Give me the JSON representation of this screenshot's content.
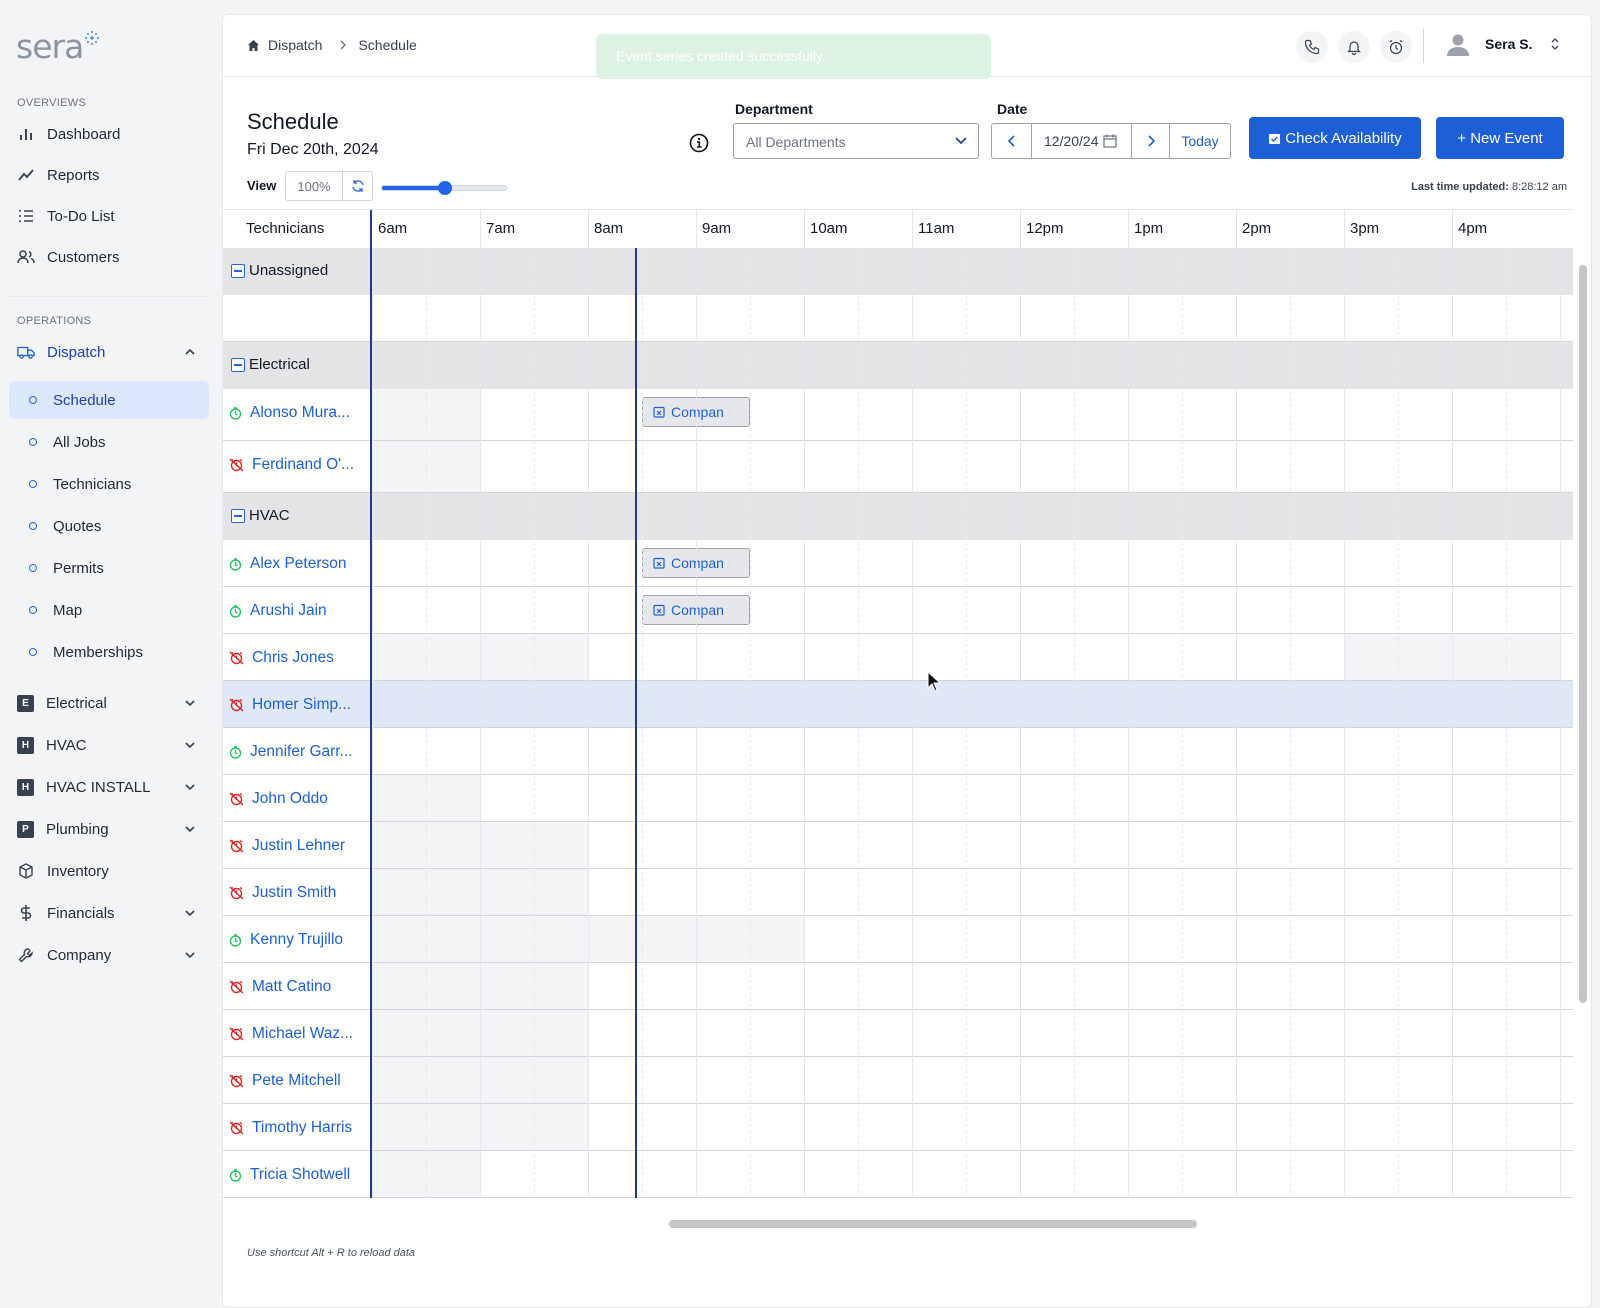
{
  "brand": {
    "logo_text": "sera"
  },
  "sidebar": {
    "overviews_label": "OVERVIEWS",
    "operations_label": "OPERATIONS",
    "overview_items": [
      {
        "label": "Dashboard",
        "icon": "bar-chart-icon"
      },
      {
        "label": "Reports",
        "icon": "trend-icon"
      },
      {
        "label": "To-Do List",
        "icon": "list-icon"
      },
      {
        "label": "Customers",
        "icon": "users-icon"
      }
    ],
    "dispatch_label": "Dispatch",
    "dispatch_sub": [
      "Schedule",
      "All Jobs",
      "Technicians",
      "Quotes",
      "Permits",
      "Map",
      "Memberships"
    ],
    "dept_items": [
      {
        "letter": "E",
        "label": "Electrical"
      },
      {
        "letter": "H",
        "label": "HVAC"
      },
      {
        "letter": "H",
        "label": "HVAC INSTALL"
      },
      {
        "letter": "P",
        "label": "Plumbing"
      }
    ],
    "inventory_label": "Inventory",
    "financials_label": "Financials",
    "company_label": "Company"
  },
  "topbar": {
    "breadcrumb": [
      "Dispatch",
      "Schedule"
    ],
    "toast": "Event series created successfully.",
    "user_name": "Sera S."
  },
  "header": {
    "title": "Schedule",
    "date": "Fri Dec 20th, 2024",
    "department_label": "Department",
    "department_value": "All Departments",
    "date_label": "Date",
    "date_value": "12/20/24",
    "today_label": "Today",
    "check_availability": "Check Availability",
    "new_event": "+ New Event",
    "view_label": "View",
    "zoom_value": "100%",
    "zoom_slider_fraction": 0.5,
    "last_updated_label": "Last time updated:",
    "last_updated_value": "8:28:12 am"
  },
  "schedule": {
    "tech_header": "Technicians",
    "hours": [
      "6am",
      "7am",
      "8am",
      "9am",
      "10am",
      "11am",
      "12pm",
      "1pm",
      "2pm",
      "3pm",
      "4pm"
    ],
    "event_label": "Compan"
  },
  "rows": [
    {
      "type": "group",
      "name": "Unassigned"
    },
    {
      "type": "empty"
    },
    {
      "type": "group",
      "name": "Electrical"
    },
    {
      "type": "tech",
      "name": "Alonso Mura...",
      "status": "on"
    },
    {
      "type": "tech",
      "name": "Ferdinand O'...",
      "status": "off"
    },
    {
      "type": "group",
      "name": "HVAC"
    },
    {
      "type": "tech",
      "name": "Alex Peterson",
      "status": "on"
    },
    {
      "type": "tech",
      "name": "Arushi Jain",
      "status": "on"
    },
    {
      "type": "tech",
      "name": "Chris Jones",
      "status": "off"
    },
    {
      "type": "tech",
      "name": "Homer Simp...",
      "status": "off"
    },
    {
      "type": "tech",
      "name": "Jennifer Garr...",
      "status": "on"
    },
    {
      "type": "tech",
      "name": "John Oddo",
      "status": "off"
    },
    {
      "type": "tech",
      "name": "Justin Lehner",
      "status": "off"
    },
    {
      "type": "tech",
      "name": "Justin Smith",
      "status": "off"
    },
    {
      "type": "tech",
      "name": "Kenny Trujillo",
      "status": "on"
    },
    {
      "type": "tech",
      "name": "Matt Catino",
      "status": "off"
    },
    {
      "type": "tech",
      "name": "Michael Waz...",
      "status": "off"
    },
    {
      "type": "tech",
      "name": "Pete Mitchell",
      "status": "off"
    },
    {
      "type": "tech",
      "name": "Timothy Harris",
      "status": "off"
    },
    {
      "type": "tech",
      "name": "Tricia Shotwell",
      "status": "on"
    }
  ],
  "footer": {
    "hint": "Use shortcut Alt + R to reload data"
  },
  "colors": {
    "primary": "#1d5fd6",
    "on": "#22c55e",
    "off": "#dc2626",
    "group_bg": "#e4e4e7"
  }
}
